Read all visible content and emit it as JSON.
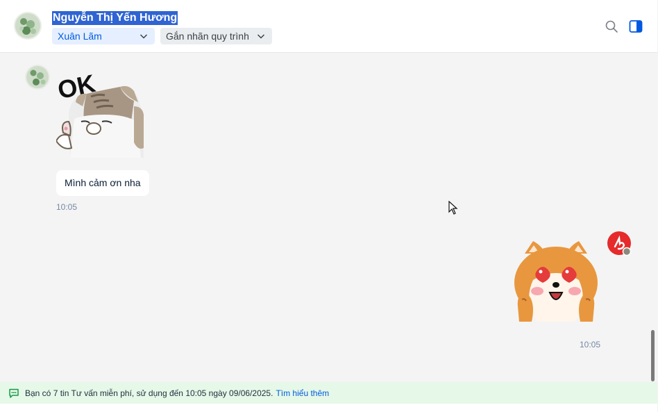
{
  "header": {
    "contact_name": "Nguyễn Thị Yến Hương",
    "assignee": "Xuân Lãm",
    "tag_label": "Gắn nhãn quy trình",
    "icons": [
      "search-icon",
      "side-panel-icon"
    ]
  },
  "messages": {
    "incoming": {
      "sticker": "ok-cat-sticker",
      "sticker_text": "OK",
      "text": "Mình cảm ơn nha",
      "time": "10:05"
    },
    "outgoing": {
      "sticker": "heart-eyes-shiba-sticker",
      "time": "10:05"
    }
  },
  "notice": {
    "text": "Bạn có 7 tin Tư vấn miễn phí, sử dụng đến 10:05 ngày 09/06/2025.",
    "link": "Tìm hiểu thêm"
  },
  "colors": {
    "accent": "#005ae0",
    "selection": "#2f64d2",
    "notice_bg": "#e6f8e8",
    "shop_brand": "#e52b2b"
  }
}
